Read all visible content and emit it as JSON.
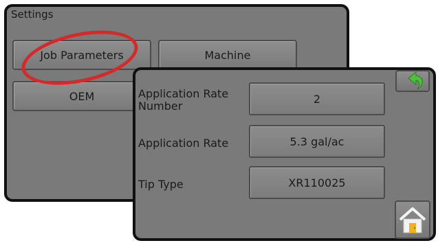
{
  "settings": {
    "title": "Settings",
    "buttons": {
      "job_parameters": "Job Parameters",
      "machine": "Machine",
      "oem": "OEM"
    }
  },
  "job_parameters": {
    "rows": [
      {
        "label": "Application Rate Number",
        "value": "2"
      },
      {
        "label": "Application Rate",
        "value": "5.3 gal/ac"
      },
      {
        "label": "Tip Type",
        "value": "XR110025"
      }
    ]
  },
  "icons": {
    "back": "back-arrow-icon",
    "home": "home-icon"
  },
  "colors": {
    "highlight": "#d42a2a",
    "back_arrow": "#4cc23a",
    "home_door": "#f0b020"
  }
}
